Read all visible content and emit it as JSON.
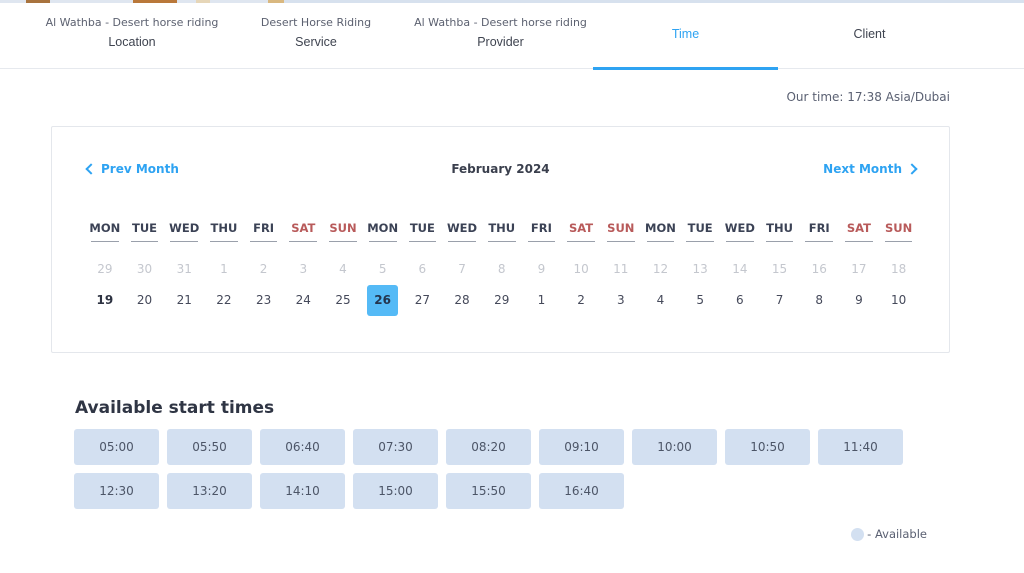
{
  "steps": [
    {
      "name": "location",
      "sub": "Al Wathba - Desert horse riding",
      "label": "Location",
      "active": false
    },
    {
      "name": "service",
      "sub": "Desert Horse Riding",
      "label": "Service",
      "active": false
    },
    {
      "name": "provider",
      "sub": "Al Wathba - Desert horse riding",
      "label": "Provider",
      "active": false
    },
    {
      "name": "time",
      "sub": "",
      "label": "Time",
      "active": true
    },
    {
      "name": "client",
      "sub": "",
      "label": "Client",
      "active": false
    }
  ],
  "our_time": "Our time: 17:38 Asia/Dubai",
  "calendar": {
    "prev_label": "Prev Month",
    "next_label": "Next Month",
    "month_title": "February 2024",
    "weekdays": [
      "MON",
      "TUE",
      "WED",
      "THU",
      "FRI",
      "SAT",
      "SUN",
      "MON",
      "TUE",
      "WED",
      "THU",
      "FRI",
      "SAT",
      "SUN",
      "MON",
      "TUE",
      "WED",
      "THU",
      "FRI",
      "SAT",
      "SUN"
    ],
    "past_days": [
      "29",
      "30",
      "31",
      "1",
      "2",
      "3",
      "4",
      "5",
      "6",
      "7",
      "8",
      "9",
      "10",
      "11",
      "12",
      "13",
      "14",
      "15",
      "16",
      "17",
      "18"
    ],
    "current_days": [
      "19",
      "20",
      "21",
      "22",
      "23",
      "24",
      "25",
      "26",
      "27",
      "28",
      "29",
      "1",
      "2",
      "3",
      "4",
      "5",
      "6",
      "7",
      "8",
      "9",
      "10"
    ],
    "today": "19",
    "selected": "26"
  },
  "available": {
    "title": "Available start times",
    "slots": [
      "05:00",
      "05:50",
      "06:40",
      "07:30",
      "08:20",
      "09:10",
      "10:00",
      "10:50",
      "11:40",
      "12:30",
      "13:20",
      "14:10",
      "15:00",
      "15:50",
      "16:40"
    ]
  },
  "legend": {
    "label": "- Available"
  },
  "colors": {
    "accent": "#2ea3f2",
    "selected_day": "#55baf6",
    "slot_bg": "#d3e0f1",
    "weekend": "#b85a5a"
  }
}
